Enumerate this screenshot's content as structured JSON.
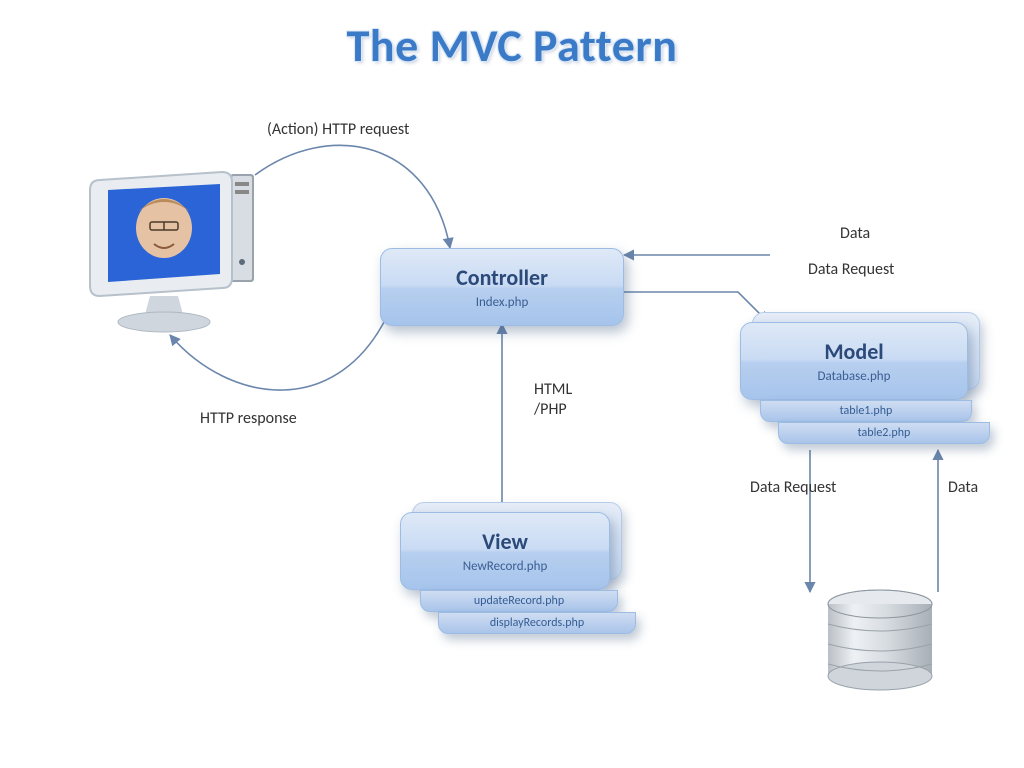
{
  "title": "The MVC Pattern",
  "labels": {
    "action_http_request": "(Action)   HTTP request",
    "http_response": "HTTP response",
    "html_php_1": "HTML",
    "html_php_2": "/PHP",
    "data_top": "Data",
    "data_request_top": "Data Request",
    "data_request_bottom": "Data Request",
    "data_bottom": "Data"
  },
  "controller": {
    "name": "Controller",
    "file": "Index.php"
  },
  "model": {
    "name": "Model",
    "files": [
      "Database.php",
      "table1.php",
      "table2.php"
    ]
  },
  "view": {
    "name": "View",
    "files": [
      "NewRecord.php",
      "updateRecord.php",
      "displayRecords.php"
    ]
  }
}
